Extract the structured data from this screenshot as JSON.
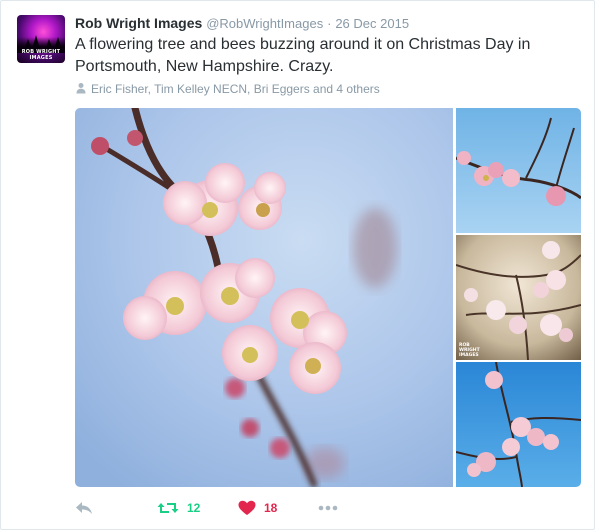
{
  "tweet": {
    "author_name": "Rob Wright Images",
    "handle": "@RobWrightImages",
    "separator": "·",
    "date": "26 Dec 2015",
    "text": "A flowering tree and bees buzzing around it on Christmas Day in Portsmouth, New Hampshire. Crazy.",
    "avatar_caption": "ROB WRIGHT IMAGES",
    "tagged_people": "Eric Fisher, Tim Kelley NECN, Bri Eggers and 4 others",
    "photo_watermark": "ROB WRIGHT IMAGES"
  },
  "actions": {
    "reply_icon": "reply-arrow-icon",
    "retweet_icon": "retweet-icon",
    "retweet_count": "12",
    "like_icon": "heart-icon",
    "like_count": "18",
    "more_icon": "ellipsis-icon"
  },
  "colors": {
    "retweet": "#19cf86",
    "like": "#e2264d",
    "muted": "#8899a6",
    "text": "#292f33",
    "border": "#e1e8ed"
  }
}
